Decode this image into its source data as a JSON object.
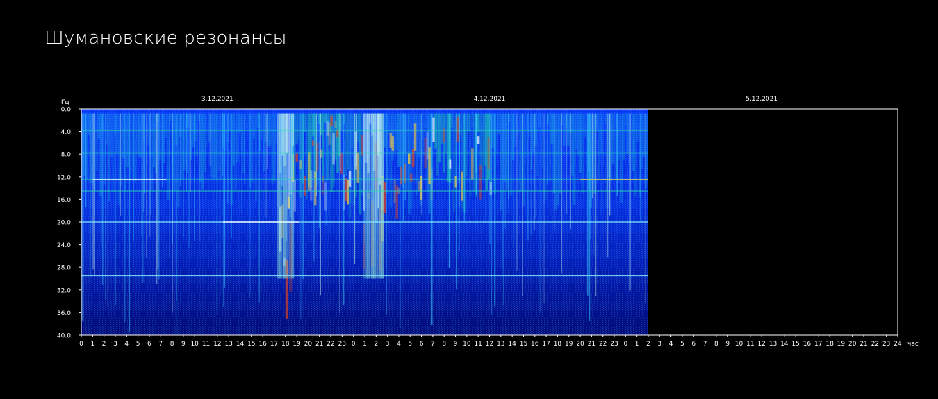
{
  "title": "Шумановские резонансы",
  "chart_data": {
    "type": "heatmap",
    "title": "Шумановские резонансы",
    "ylabel": "Гц",
    "xlabel": "час",
    "ylim": [
      0,
      40
    ],
    "y_ticks": [
      "0.0",
      "4.0",
      "8.0",
      "12.0",
      "16.0",
      "20.0",
      "24.0",
      "28.0",
      "32.0",
      "36.0",
      "40.0"
    ],
    "x_range_hours": [
      0,
      72
    ],
    "x_tick_labels": [
      "0",
      "1",
      "2",
      "3",
      "4",
      "5",
      "6",
      "7",
      "8",
      "9",
      "10",
      "11",
      "12",
      "13",
      "14",
      "15",
      "16",
      "17",
      "18",
      "19",
      "20",
      "21",
      "22",
      "23",
      "0",
      "1",
      "2",
      "3",
      "4",
      "5",
      "6",
      "7",
      "8",
      "9",
      "10",
      "11",
      "12",
      "13",
      "14",
      "15",
      "16",
      "17",
      "18",
      "19",
      "20",
      "21",
      "22",
      "23",
      "0",
      "1",
      "2",
      "3",
      "4",
      "5",
      "6",
      "7",
      "8",
      "9",
      "10",
      "11",
      "12",
      "13",
      "14",
      "15",
      "16",
      "17",
      "18",
      "19",
      "20",
      "21",
      "22",
      "23",
      "24"
    ],
    "dates": [
      {
        "label": "3.12.2021",
        "hour": 12
      },
      {
        "label": "4.12.2021",
        "hour": 36
      },
      {
        "label": "5.12.2021",
        "hour": 60
      }
    ],
    "data_end_hour": 50,
    "grid": false,
    "colors": {
      "background": "#000000",
      "low": "#00108c",
      "mid": "#0a5cff",
      "high": "#22e6a0",
      "peak": "#ffffff",
      "frame": "#ffffff"
    },
    "resonance_bands_hz": [
      3.8,
      7.8,
      12.5,
      14.5,
      20,
      29.5
    ],
    "intensity_hour_bands": [
      {
        "from": 0,
        "to": 17.2,
        "level": 0.55
      },
      {
        "from": 17.2,
        "to": 18.6,
        "level": 1.0
      },
      {
        "from": 18.6,
        "to": 21.5,
        "level": 0.75
      },
      {
        "from": 21.5,
        "to": 24.8,
        "level": 0.8
      },
      {
        "from": 24.8,
        "to": 26.5,
        "level": 1.0
      },
      {
        "from": 26.5,
        "to": 31.0,
        "level": 0.7
      },
      {
        "from": 31.0,
        "to": 36.0,
        "level": 0.85
      },
      {
        "from": 36.0,
        "to": 43.0,
        "level": 0.65
      },
      {
        "from": 43.0,
        "to": 50.0,
        "level": 0.6
      }
    ]
  }
}
